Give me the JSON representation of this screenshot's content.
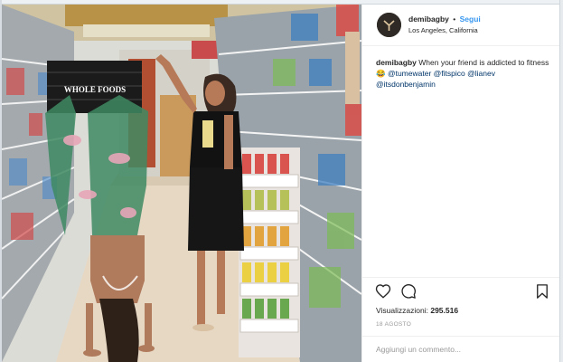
{
  "post": {
    "username": "demibagby",
    "separator": "•",
    "follow_label": "Segui",
    "location": "Los Angeles, California",
    "caption_user": "demibagby",
    "caption_text": "When your friend is addicted to fitness",
    "caption_emoji": "😂",
    "mentions": [
      "@tumewater",
      "@fitspico",
      "@lianev",
      "@itsdonbenjamin"
    ],
    "views_label": "Visualizzazioni:",
    "views_count": "295.516",
    "date": "18 AGOSTO",
    "comment_placeholder": "Aggiungi un commento..."
  },
  "media": {
    "basket_logo": "WHOLE FOODS"
  },
  "icons": {
    "like": "heart-icon",
    "comment": "comment-icon",
    "save": "bookmark-icon",
    "avatar": "avatar"
  },
  "colors": {
    "link_blue": "#3897f0",
    "mention": "#003569",
    "muted": "#999999",
    "text": "#262626"
  }
}
